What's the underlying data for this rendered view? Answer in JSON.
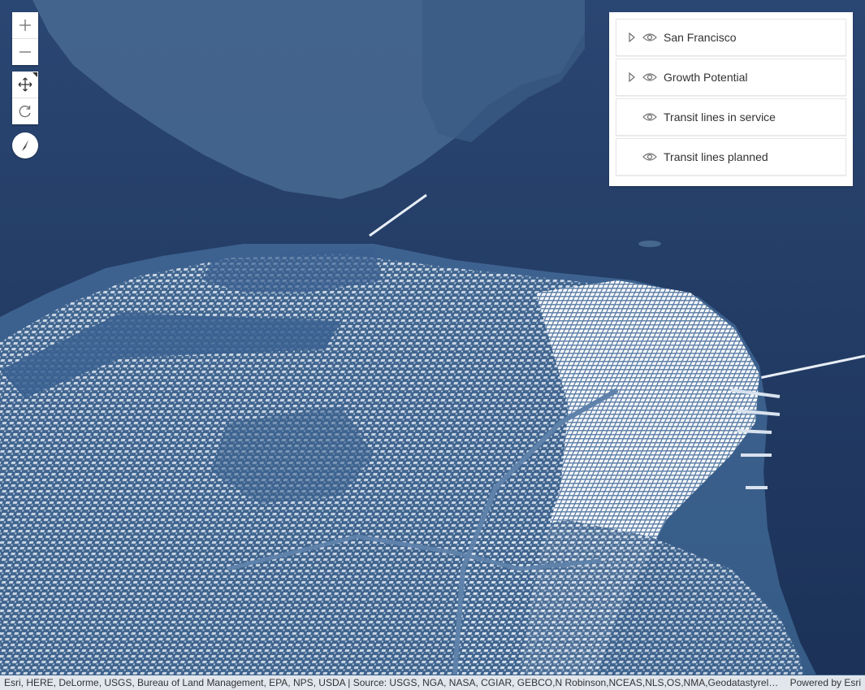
{
  "scene": {
    "colors": {
      "water": "#1c3358",
      "land": "#365d88",
      "buildings": "#ffffff"
    }
  },
  "navigation": {
    "zoom_in_icon": "plus-icon",
    "zoom_out_icon": "minus-icon",
    "pan_icon": "pan-move-icon",
    "rotate_icon": "rotate-icon",
    "compass_icon": "compass-icon"
  },
  "layer_list": {
    "items": [
      {
        "label": "San Francisco",
        "expandable": true
      },
      {
        "label": "Growth Potential",
        "expandable": true
      },
      {
        "label": "Transit lines in service",
        "expandable": false
      },
      {
        "label": "Transit lines planned",
        "expandable": false
      }
    ]
  },
  "attribution": {
    "text": "Esri, HERE, DeLorme, USGS, Bureau of Land Management, EPA, NPS, USDA | Source: USGS, NGA, NASA, CGIAR, GEBCO,N Robinson,NCEAS,NLS,OS,NMA,Geodatastyrelsen …",
    "powered_by": "Powered by Esri"
  }
}
